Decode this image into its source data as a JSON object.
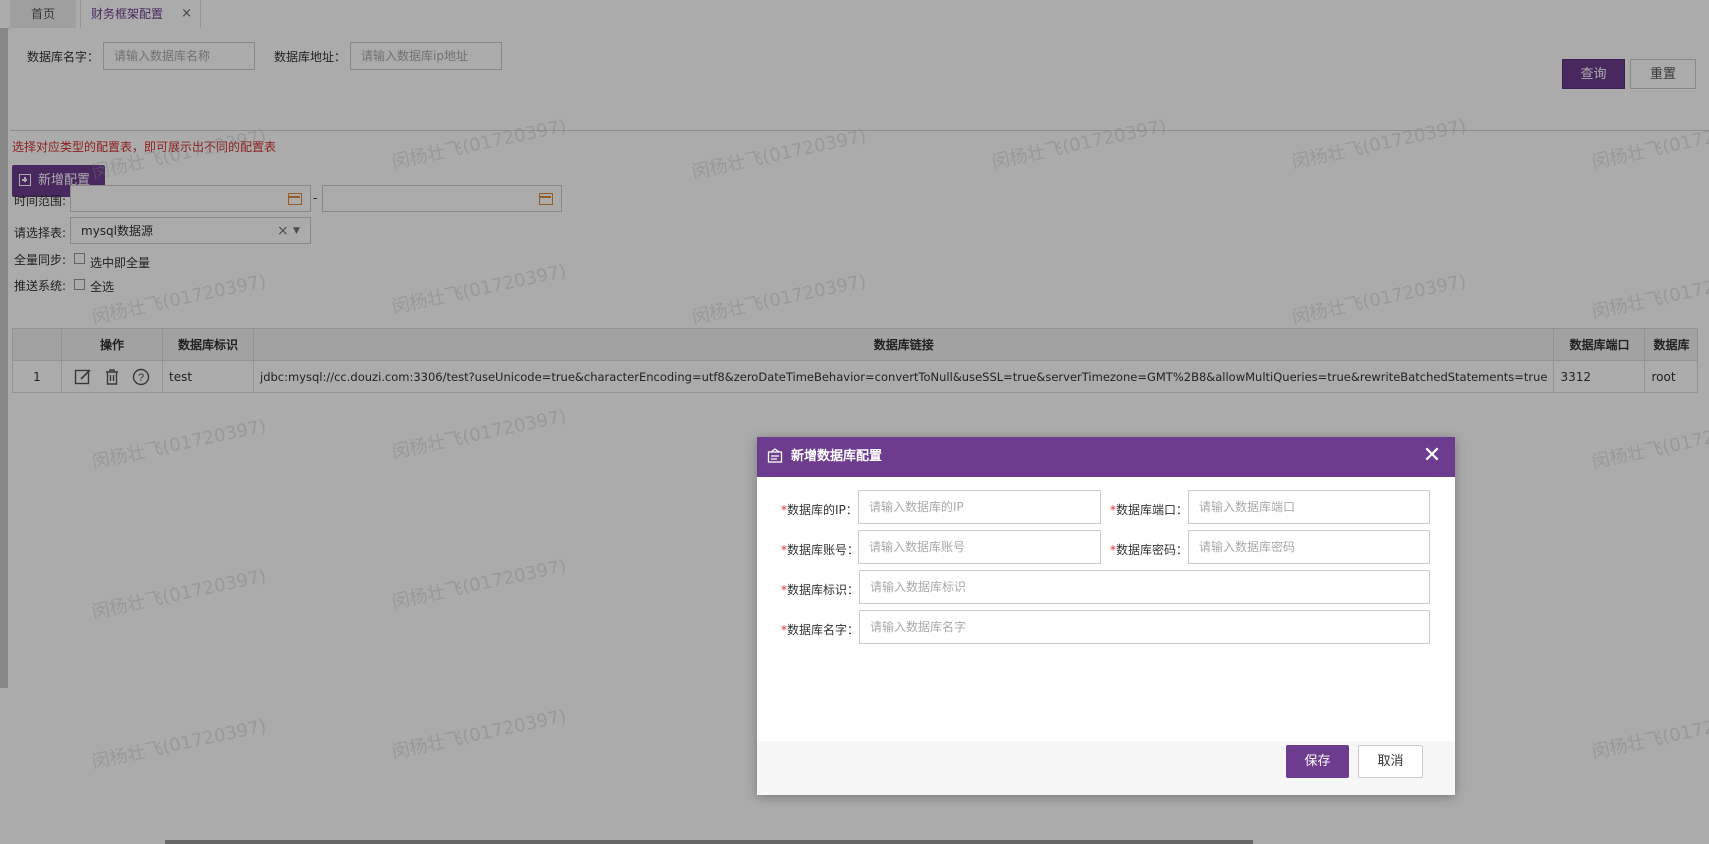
{
  "tabs": {
    "home": "首页",
    "active": "财务框架配置",
    "close": "×"
  },
  "search": {
    "db_name_label": "数据库名字：",
    "db_name_placeholder": "请输入数据库名称",
    "db_addr_label": "数据库地址：",
    "db_addr_placeholder": "请输入数据库ip地址",
    "query_button": "查询",
    "reset_button": "重置"
  },
  "hint": "选择对应类型的配置表，即可展示出不同的配置表",
  "add_button": "新增配置",
  "filters": {
    "time_range_label": "时间范围:",
    "range_separator": "-",
    "select_table_label": "请选择表:",
    "select_table_value": "mysql数据源",
    "full_sync_label": "全量同步:",
    "full_sync_option": "选中即全量",
    "push_system_label": "推送系统:",
    "push_system_option": "全选"
  },
  "table": {
    "headers": [
      "",
      "操作",
      "数据库标识",
      "数据库链接",
      "数据库端口",
      "数据库"
    ],
    "rows": [
      {
        "index": "1",
        "id": "test",
        "link": "jdbc:mysql://cc.douzi.com:3306/test?useUnicode=true&characterEncoding=utf8&zeroDateTimeBehavior=convertToNull&useSSL=true&serverTimezone=GMT%2B8&allowMultiQueries=true&rewriteBatchedStatements=true",
        "port": "3312",
        "user": "root"
      }
    ]
  },
  "watermark": "闵杨壮飞(01720397)",
  "modal": {
    "title": "新增数据库配置",
    "required_mark": "*",
    "fields": {
      "ip_label": "数据库的IP：",
      "ip_placeholder": "请输入数据库的IP",
      "port_label": "数据库端口：",
      "port_placeholder": "请输入数据库端口",
      "account_label": "数据库账号：",
      "account_placeholder": "请输入数据库账号",
      "password_label": "数据库密码：",
      "password_placeholder": "请输入数据库密码",
      "id_label": "数据库标识：",
      "id_placeholder": "请输入数据库标识",
      "name_label": "数据库名字：",
      "name_placeholder": "请输入数据库名字"
    },
    "save_button": "保存",
    "cancel_button": "取消"
  },
  "colors": {
    "accent": "#6d3c8f",
    "hint": "#d43030",
    "calendar": "#e08a3a"
  }
}
